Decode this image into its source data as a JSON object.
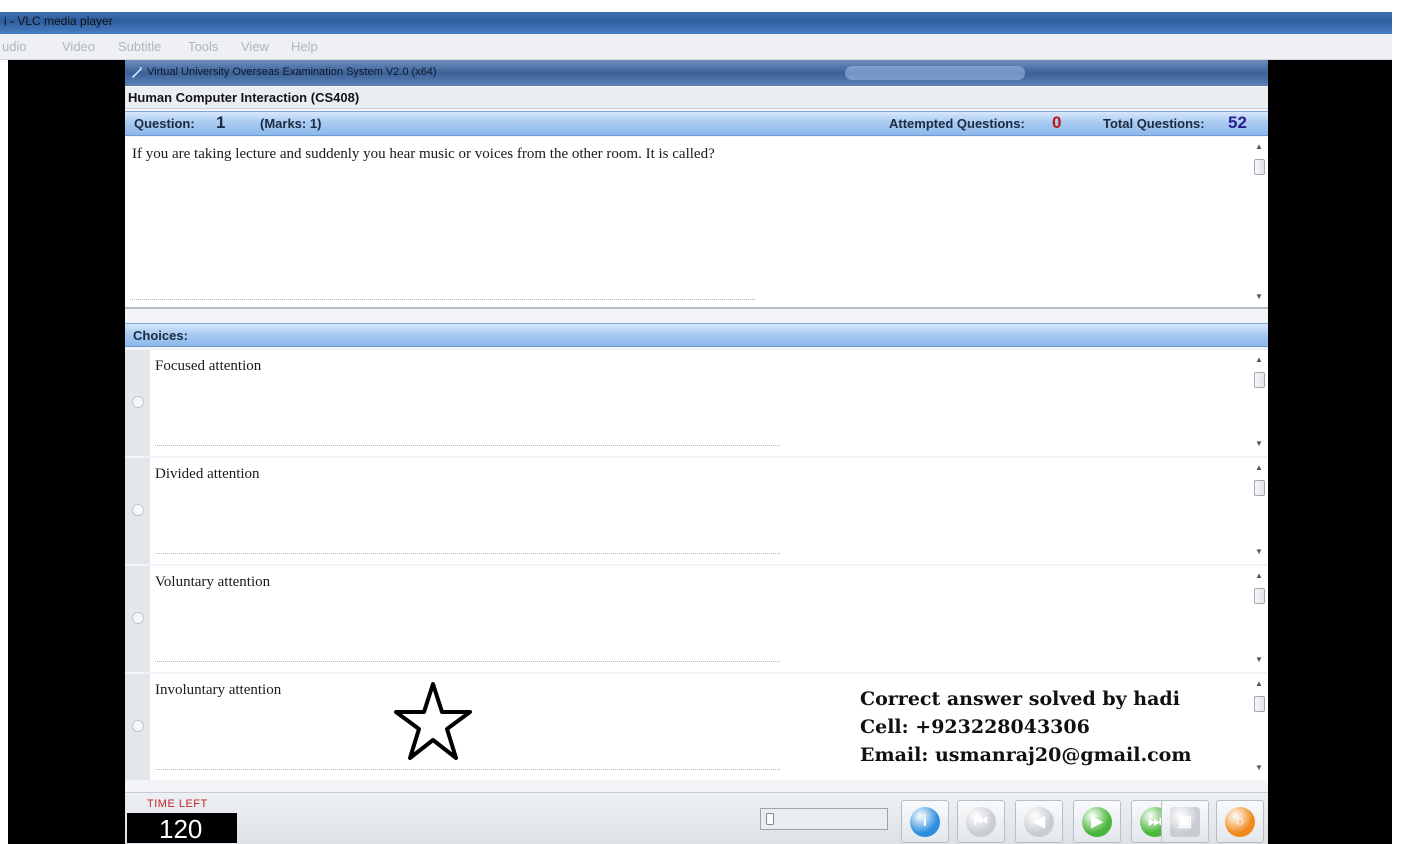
{
  "vlc": {
    "title": "i - VLC media player",
    "menu": [
      "udio",
      "Video",
      "Subtitle",
      "Tools",
      "View",
      "Help"
    ]
  },
  "app": {
    "title": "Virtual University Overseas Examination System  V2.0 (x64)",
    "course": "Human Computer Interaction  (CS408)"
  },
  "question_bar": {
    "question_label": "Question:",
    "question_number": "1",
    "marks": "(Marks: 1)",
    "attempted_label": "Attempted Questions:",
    "attempted_value": "0",
    "total_label": "Total Questions:",
    "total_value": "52"
  },
  "question": {
    "text": "If you are taking lecture and suddenly you hear music or voices from the other room. It is called?"
  },
  "choices": {
    "label": "Choices:",
    "items": [
      "Focused attention",
      "Divided attention",
      "Voluntary attention",
      "Involuntary attention"
    ]
  },
  "footer": {
    "time_left_label": "TIME LEFT",
    "time_left_value": "120",
    "slider_value": 0,
    "buttons": [
      {
        "icon": "info-icon",
        "color": "#2d8ee0"
      },
      {
        "icon": "first-question-icon",
        "color": "#c9cdd3"
      },
      {
        "icon": "previous-question-icon",
        "color": "#c9cdd3"
      },
      {
        "icon": "next-question-icon",
        "color": "#49b53a"
      },
      {
        "icon": "last-question-icon",
        "color": "#49b53a"
      },
      {
        "icon": "save-icon",
        "color": "#c9cdd3"
      },
      {
        "icon": "finish-icon",
        "color": "#f08a1c"
      }
    ]
  },
  "overlay": {
    "line1": "Correct answer solved by hadi",
    "line2": "Cell: +923228043306",
    "line3": "Email: usmanraj20@gmail.com"
  }
}
